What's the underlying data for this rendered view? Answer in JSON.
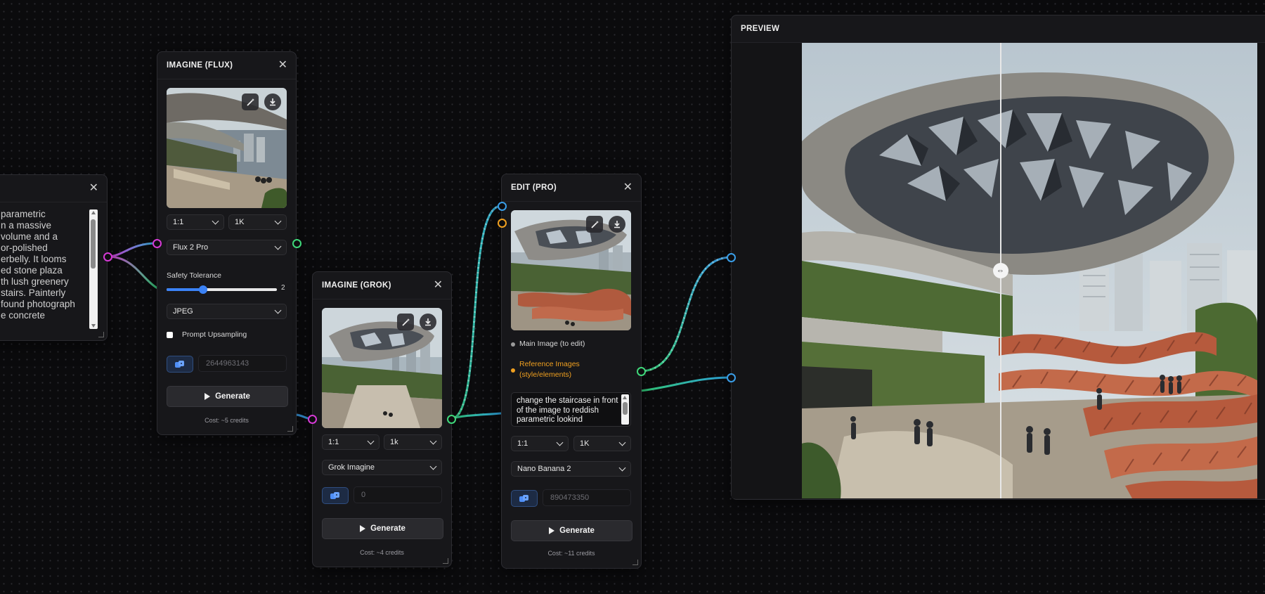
{
  "prompt_node": {
    "lines": [
      " parametric",
      "n a massive",
      "volume and a",
      "or-polished",
      "erbelly. It looms",
      "ed stone plaza",
      "th lush greenery",
      "stairs. Painterly",
      "found photograph",
      "e concrete"
    ]
  },
  "flux_node": {
    "title": "IMAGINE (FLUX)",
    "aspect": "1:1",
    "resolution": "1K",
    "model": "Flux 2 Pro",
    "safety_label": "Safety Tolerance",
    "safety_value": "2",
    "safety_fraction": 0.33,
    "format": "JPEG",
    "upsampling_label": "Prompt Upsampling",
    "seed": "2644963143",
    "generate": "Generate",
    "cost": "Cost: ~5 credits"
  },
  "grok_node": {
    "title": "IMAGINE (GROK)",
    "aspect": "1:1",
    "resolution": "1k",
    "model": "Grok Imagine",
    "seed": "0",
    "generate": "Generate",
    "cost": "Cost: ~4 credits"
  },
  "edit_node": {
    "title": "EDIT (PRO)",
    "main_image_label": "Main Image (to edit)",
    "reference_label_1": "Reference Images",
    "reference_label_2": "(style/elements)",
    "prompt": "change the staircase in front of the image to reddish parametric lookind",
    "aspect": "1:1",
    "resolution": "1K",
    "model": "Nano Banana 2",
    "seed": "890473350",
    "generate": "Generate",
    "cost": "Cost: ~11 credits"
  },
  "preview_node": {
    "title": "PREVIEW",
    "compare_split": 0.436
  },
  "colors": {
    "port_magenta": "#d63ad6",
    "port_green": "#3fd87a",
    "port_blue": "#3a9ee8",
    "port_orange": "#f0a020",
    "accent_blue": "#3b82f6",
    "reference_orange": "#f0a020"
  },
  "icons": {
    "enhance": "magic-wand-icon",
    "download": "download-icon",
    "seed": "dice-icon",
    "play": "play-icon",
    "close": "close-icon"
  }
}
